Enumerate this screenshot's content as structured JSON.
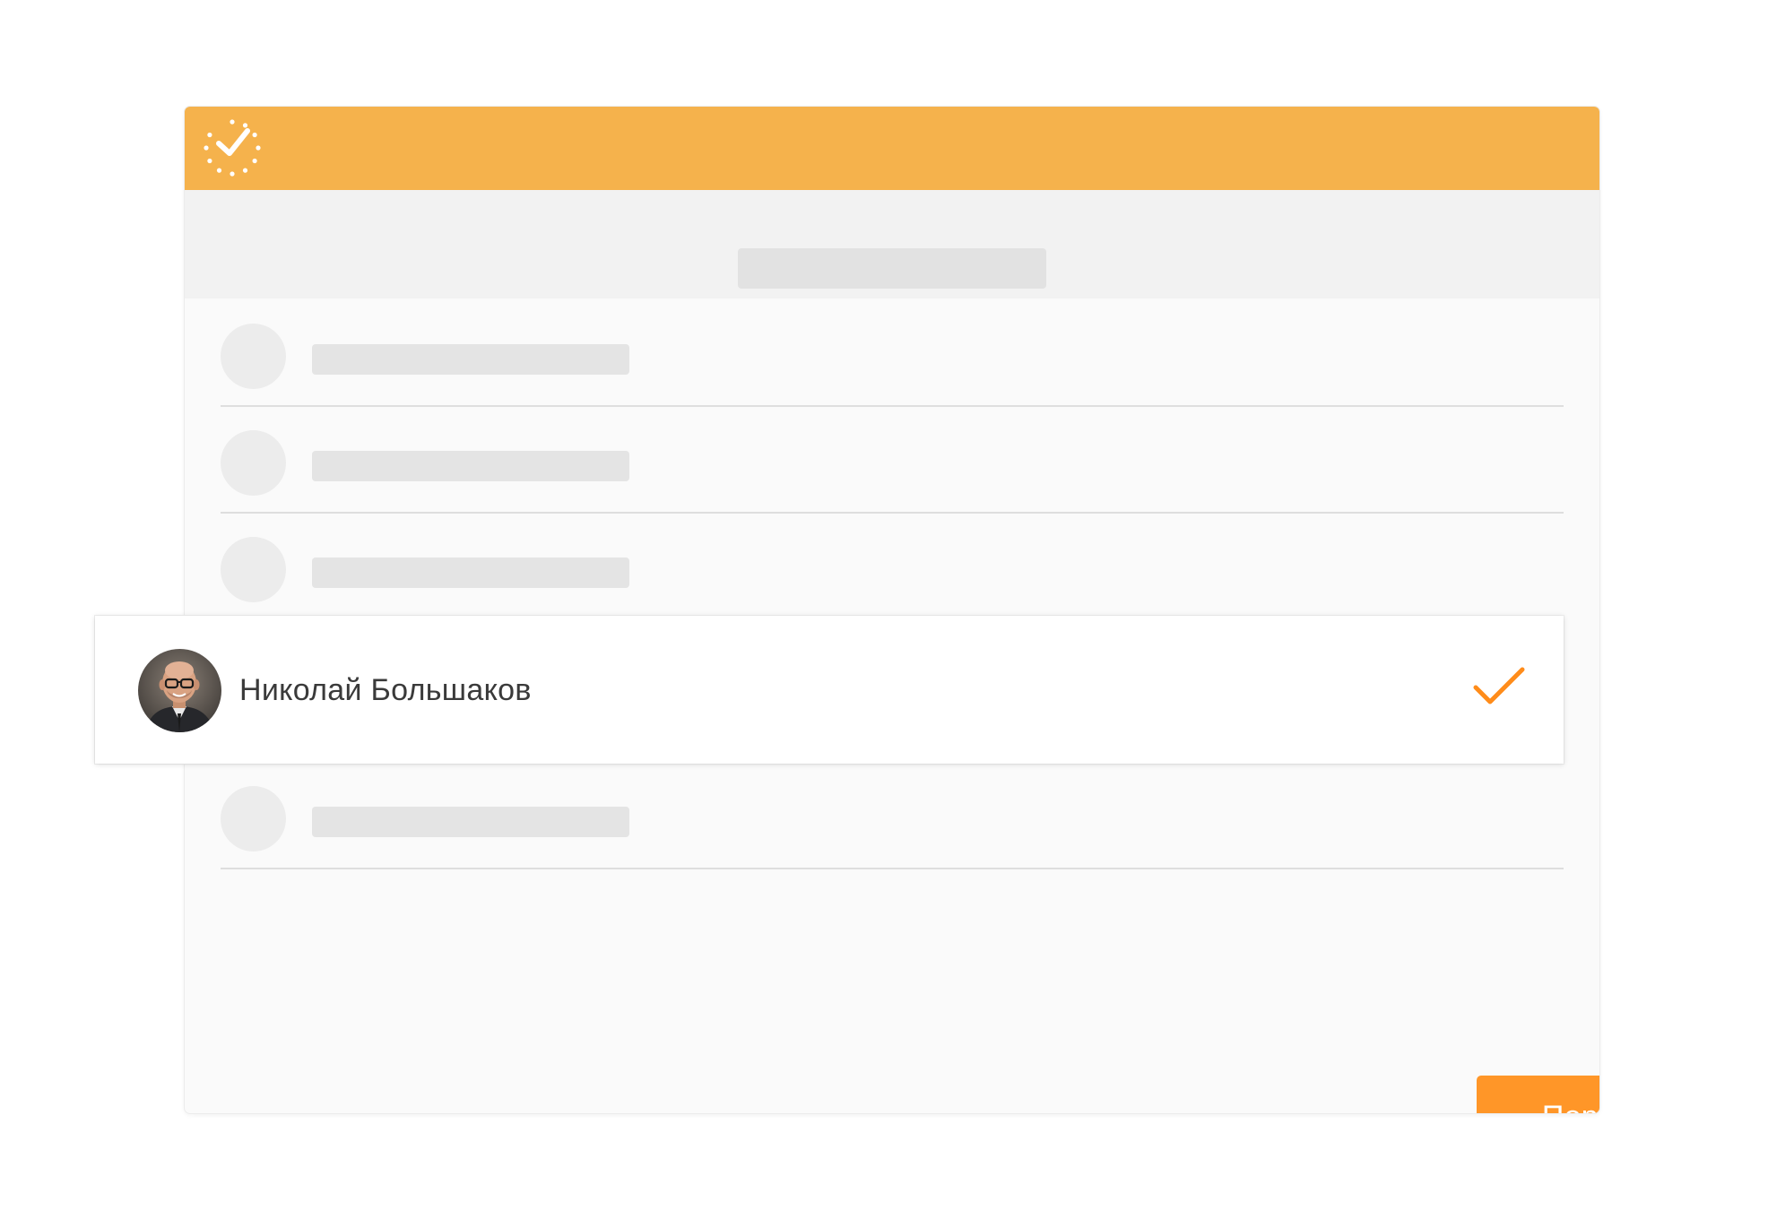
{
  "app": {
    "icon": "clock-check-icon",
    "header_color": "#f5b24c"
  },
  "assignee_list": {
    "selected": {
      "name": "Николай Большаков",
      "avatar": "user-photo",
      "state_icon": "checkmark-icon",
      "check_color": "#ff8c1a"
    }
  },
  "footer": {
    "assign_button_label": "Поручить",
    "button_color": "#ff9628"
  }
}
